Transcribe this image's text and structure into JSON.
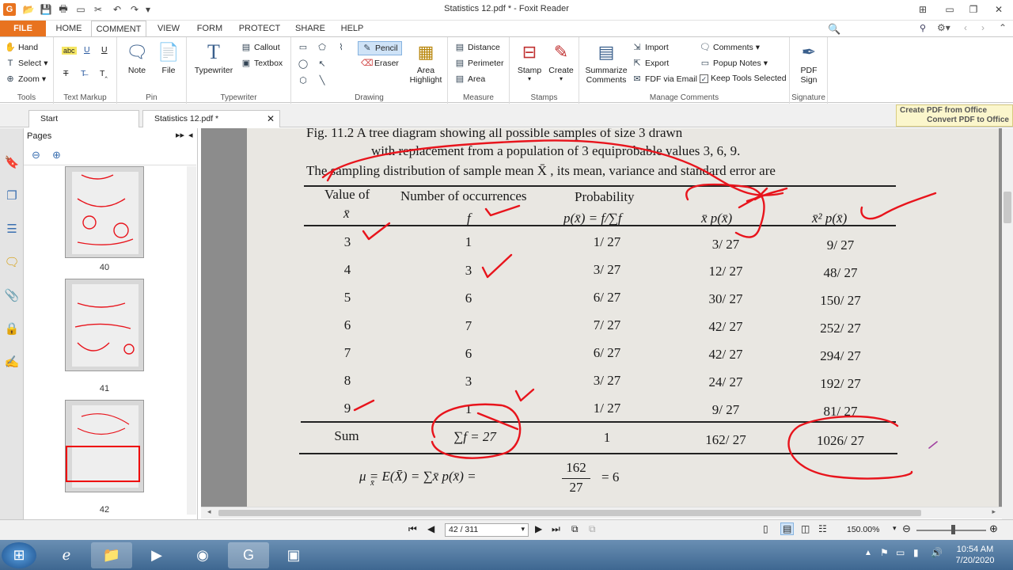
{
  "window": {
    "title": "Statistics 12.pdf * - Foxit Reader",
    "app_logo": "G"
  },
  "ribbon_tabs": [
    "FILE",
    "HOME",
    "COMMENT",
    "VIEW",
    "FORM",
    "PROTECT",
    "SHARE",
    "HELP"
  ],
  "active_tab": "COMMENT",
  "search": {
    "placeholder": "Find"
  },
  "ribbon": {
    "tools": {
      "label": "Tools",
      "items": [
        "Hand",
        "Select",
        "Zoom"
      ]
    },
    "text_markup": {
      "label": "Text Markup"
    },
    "pin": {
      "label": "Pin",
      "note": "Note",
      "file": "File"
    },
    "typewriter": {
      "label": "Typewriter",
      "typewriter": "Typewriter",
      "callout": "Callout",
      "textbox": "Textbox"
    },
    "drawing": {
      "label": "Drawing",
      "pencil": "Pencil",
      "eraser": "Eraser",
      "area_highlight": "Area\nHighlight"
    },
    "measure": {
      "label": "Measure",
      "distance": "Distance",
      "perimeter": "Perimeter",
      "area": "Area"
    },
    "stamps": {
      "label": "Stamps",
      "stamp": "Stamp",
      "create": "Create"
    },
    "manage": {
      "label": "Manage Comments",
      "summarize": "Summarize\nComments",
      "import": "Import",
      "export": "Export",
      "fdf": "FDF via Email",
      "comments": "Comments",
      "popup": "Popup Notes",
      "keep": "Keep Tools Selected"
    },
    "signature": {
      "label": "Signature",
      "pdfsign": "PDF\nSign"
    }
  },
  "doc_tabs": {
    "start": "Start",
    "file": "Statistics 12.pdf *"
  },
  "promo": {
    "line1": "Create PDF from Office",
    "line2": "Convert PDF to Office"
  },
  "pages_panel": {
    "title": "Pages",
    "thumbs": [
      "40",
      "41",
      "42"
    ]
  },
  "document": {
    "caption1": "Fig. 11.2  A tree diagram showing all possible samples of  size  3  drawn",
    "caption2": "with replacement from a population of  3  equiprobable values  3,  6,  9.",
    "intro": "The sampling distribution of sample mean  X̄ , its mean, variance and standard error are",
    "headers": {
      "value_of": "Value of",
      "xbar": "x̄",
      "occurrences": "Number of occurrences",
      "f": "f",
      "probability": "Probability",
      "prob_formula": "p(x̄)  =  f/∑f",
      "xp": "x̄  p(x̄)",
      "x2p": "x̄²  p(x̄)"
    },
    "rows": [
      [
        "3",
        "1",
        "1/ 27",
        "3/ 27",
        "9/ 27"
      ],
      [
        "4",
        "3",
        "3/ 27",
        "12/ 27",
        "48/ 27"
      ],
      [
        "5",
        "6",
        "6/ 27",
        "30/ 27",
        "150/ 27"
      ],
      [
        "6",
        "7",
        "7/ 27",
        "42/ 27",
        "252/ 27"
      ],
      [
        "7",
        "6",
        "6/ 27",
        "42/ 27",
        "294/ 27"
      ],
      [
        "8",
        "3",
        "3/ 27",
        "24/ 27",
        "192/ 27"
      ],
      [
        "9",
        "1",
        "1/ 27",
        "9/ 27",
        "81/ 27"
      ]
    ],
    "sum_row": [
      "Sum",
      "∑f  =  27",
      "1",
      "162/ 27",
      "1026/ 27"
    ],
    "formula": "μ  =  E(X̄)  =  ∑x̄ p(x̄)  =",
    "formula_sub": "x̄",
    "frac_num": "162",
    "frac_den": "27",
    "formula_result": "=  6"
  },
  "status": {
    "page": "42 / 311",
    "zoom": "150.00%"
  },
  "clock": {
    "time": "10:54 AM",
    "date": "7/20/2020"
  },
  "annotation_color": "#e8141c"
}
